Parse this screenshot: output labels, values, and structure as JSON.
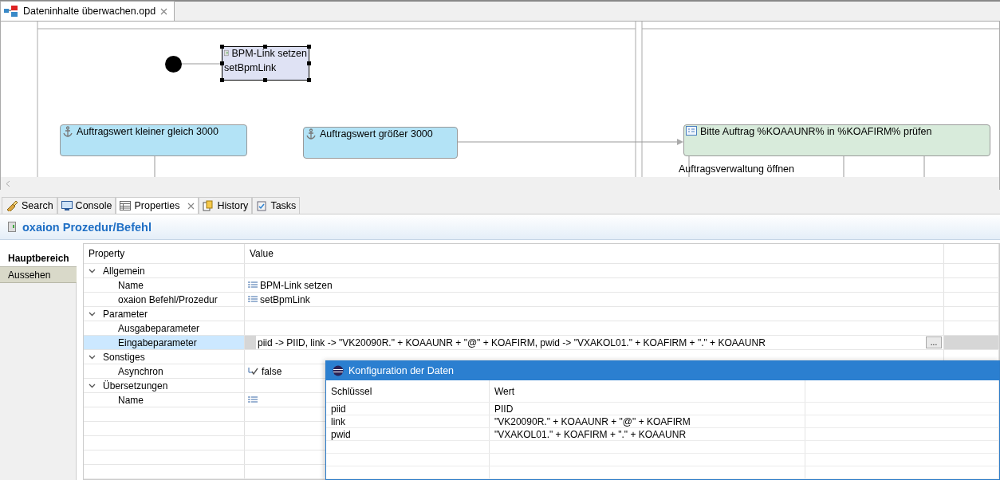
{
  "editor_tab": {
    "title": "Dateninhalte überwachen.opd",
    "closable": true
  },
  "diagram": {
    "nodes": [
      {
        "kind": "start"
      },
      {
        "kind": "task",
        "label": "BPM-Link setzen",
        "subtitle": "setBpmLink",
        "selected": true
      },
      {
        "kind": "condition",
        "label": "Auftragswert kleiner gleich 3000",
        "selected": false
      },
      {
        "kind": "condition",
        "label": "Auftragswert größer 3000",
        "selected": false
      },
      {
        "kind": "activity",
        "label": "Bitte Auftrag %KOAAUNR% in %KOAFIRM% prüfen",
        "selected": false
      }
    ],
    "edge_labels": [
      "Auftragsverwaltung öffnen"
    ]
  },
  "view_tabs": [
    {
      "label": "Search",
      "kind": "search",
      "selected": false,
      "closable": false
    },
    {
      "label": "Console",
      "kind": "console",
      "selected": false,
      "closable": false
    },
    {
      "label": "Properties",
      "kind": "properties",
      "selected": true,
      "closable": true
    },
    {
      "label": "History",
      "kind": "history",
      "selected": false,
      "closable": false
    },
    {
      "label": "Tasks",
      "kind": "tasks",
      "selected": false,
      "closable": false
    }
  ],
  "properties": {
    "title": "oxaion Prozedur/Befehl",
    "side_tabs": [
      {
        "label": "Hauptbereich",
        "selected": true
      },
      {
        "label": "Aussehen",
        "selected": false
      }
    ],
    "columns": [
      "Property",
      "Value"
    ],
    "rows": [
      {
        "kind": "category",
        "label": "Allgemein",
        "expanded": true
      },
      {
        "kind": "text",
        "label": "Name",
        "value": "BPM-Link setzen",
        "selected": false
      },
      {
        "kind": "text",
        "label": "oxaion Befehl/Prozedur",
        "value": "setBpmLink",
        "selected": false
      },
      {
        "kind": "category",
        "label": "Parameter",
        "expanded": true
      },
      {
        "kind": "empty",
        "label": "Ausgabeparameter",
        "selected": false
      },
      {
        "kind": "editing",
        "label": "Eingabeparameter",
        "value": "piid -> PIID, link -> \"VK20090R.\" + KOAAUNR + \"@\" + KOAFIRM, pwid -> \"VXAKOL01.\" + KOAFIRM + \".\" + KOAAUNR",
        "button": "...",
        "selected": true
      },
      {
        "kind": "category",
        "label": "Sonstiges",
        "expanded": true
      },
      {
        "kind": "bool",
        "label": "Asynchron",
        "value": "false",
        "selected": false
      },
      {
        "kind": "category",
        "label": "Übersetzungen",
        "expanded": true
      },
      {
        "kind": "text",
        "label": "Name",
        "selected": false
      }
    ]
  },
  "dialog": {
    "title": "Konfiguration der Daten",
    "columns": [
      "Schlüssel",
      "Wert"
    ],
    "rows": [
      {
        "key": "piid",
        "value": "PIID"
      },
      {
        "key": "link",
        "value": "\"VK20090R.\" + KOAAUNR + \"@\" + KOAFIRM"
      },
      {
        "key": "pwid",
        "value": "\"VXAKOL01.\" + KOAFIRM + \".\" + KOAAUNR"
      }
    ]
  }
}
